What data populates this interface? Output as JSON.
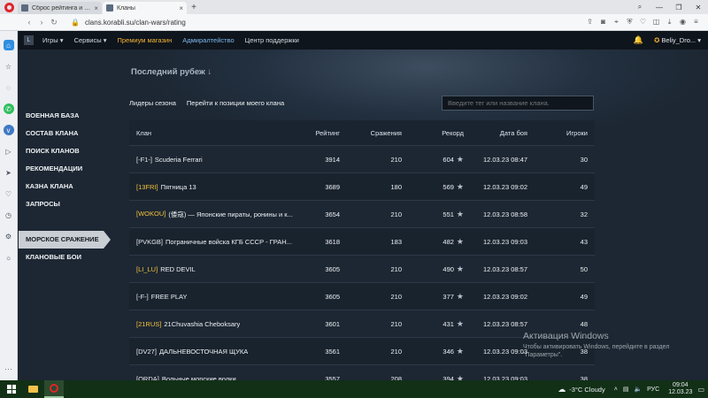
{
  "browser": {
    "tabs": [
      {
        "title": "Сброс рейтинга и истори...",
        "active": false
      },
      {
        "title": "Кланы",
        "active": true
      }
    ],
    "url": "clans.korabli.su/clan-wars/rating"
  },
  "sitenav": {
    "items": [
      "Игры",
      "Сервисы",
      "Премиум магазин",
      "Адмиралтейство",
      "Центр поддержки"
    ],
    "user": "Beliy_Dro..."
  },
  "section_title": "Последний рубеж",
  "subtabs": [
    "Лидеры сезона",
    "Перейти к позиции моего клана"
  ],
  "search": {
    "placeholder": "Введите тег или название клана."
  },
  "menu": {
    "items": [
      "ВОЕННАЯ БАЗА",
      "СОСТАВ КЛАНА",
      "ПОИСК КЛАНОВ",
      "РЕКОМЕНДАЦИИ",
      "КАЗНА КЛАНА",
      "ЗАПРОСЫ"
    ],
    "selected": "МОРСКОЕ СРАЖЕНИЕ",
    "after": "КЛАНОВЫЕ БОИ"
  },
  "table": {
    "headers": {
      "clan": "Клан",
      "rating": "Рейтинг",
      "battles": "Сражения",
      "record": "Рекорд",
      "date": "Дата боя",
      "players": "Игроки"
    },
    "rows": [
      {
        "tag": "[-F1-]",
        "name": "Scuderia Ferrari",
        "rating": "3914",
        "battles": "210",
        "record": "604",
        "date": "12.03.23 08:47",
        "players": "30",
        "gold": false
      },
      {
        "tag": "[13FRI]",
        "name": "Пятница 13",
        "rating": "3689",
        "battles": "180",
        "record": "569",
        "date": "12.03.23 09:02",
        "players": "49",
        "gold": true
      },
      {
        "tag": "[WOKOU]",
        "name": "(倭寇) — Японские пираты, ронины и к...",
        "rating": "3654",
        "battles": "210",
        "record": "551",
        "date": "12.03.23 08:58",
        "players": "32",
        "gold": true
      },
      {
        "tag": "[PVKGB]",
        "name": "Пограничные войска КГБ СССР - ГРАН...",
        "rating": "3618",
        "battles": "183",
        "record": "482",
        "date": "12.03.23 09:03",
        "players": "43",
        "gold": false
      },
      {
        "tag": "[LI_LU]",
        "name": "RED DEVIL",
        "rating": "3605",
        "battles": "210",
        "record": "490",
        "date": "12.03.23 08:57",
        "players": "50",
        "gold": true
      },
      {
        "tag": "[-F-]",
        "name": "FREE PLAY",
        "rating": "3605",
        "battles": "210",
        "record": "377",
        "date": "12.03.23 09:02",
        "players": "49",
        "gold": false
      },
      {
        "tag": "[21RUS]",
        "name": "21Chuvashia Cheboksary",
        "rating": "3601",
        "battles": "210",
        "record": "431",
        "date": "12.03.23 08:57",
        "players": "48",
        "gold": true
      },
      {
        "tag": "[DV27]",
        "name": "ДАЛЬНЕВОСТОЧНАЯ ЩУКА",
        "rating": "3561",
        "battles": "210",
        "record": "346",
        "date": "12.03.23 09:03",
        "players": "38",
        "gold": false
      },
      {
        "tag": "[ORDA]",
        "name": "Вольные морские волки",
        "rating": "3557",
        "battles": "208",
        "record": "394",
        "date": "12.03.23 09:03",
        "players": "38",
        "gold": false
      }
    ]
  },
  "watermark": {
    "line1": "Активация Windows",
    "line2": "Чтобы активировать Windows, перейдите в раздел \"Параметры\"."
  },
  "taskbar": {
    "weather": "-3°C  Cloudy",
    "lang": "РУС",
    "time": "09:04",
    "date": "12.03.23"
  },
  "colors": {
    "gold": "#f3c23c",
    "premium": "#f2b233",
    "admiral": "#7db9ef",
    "opera_red": "#e0262c"
  }
}
